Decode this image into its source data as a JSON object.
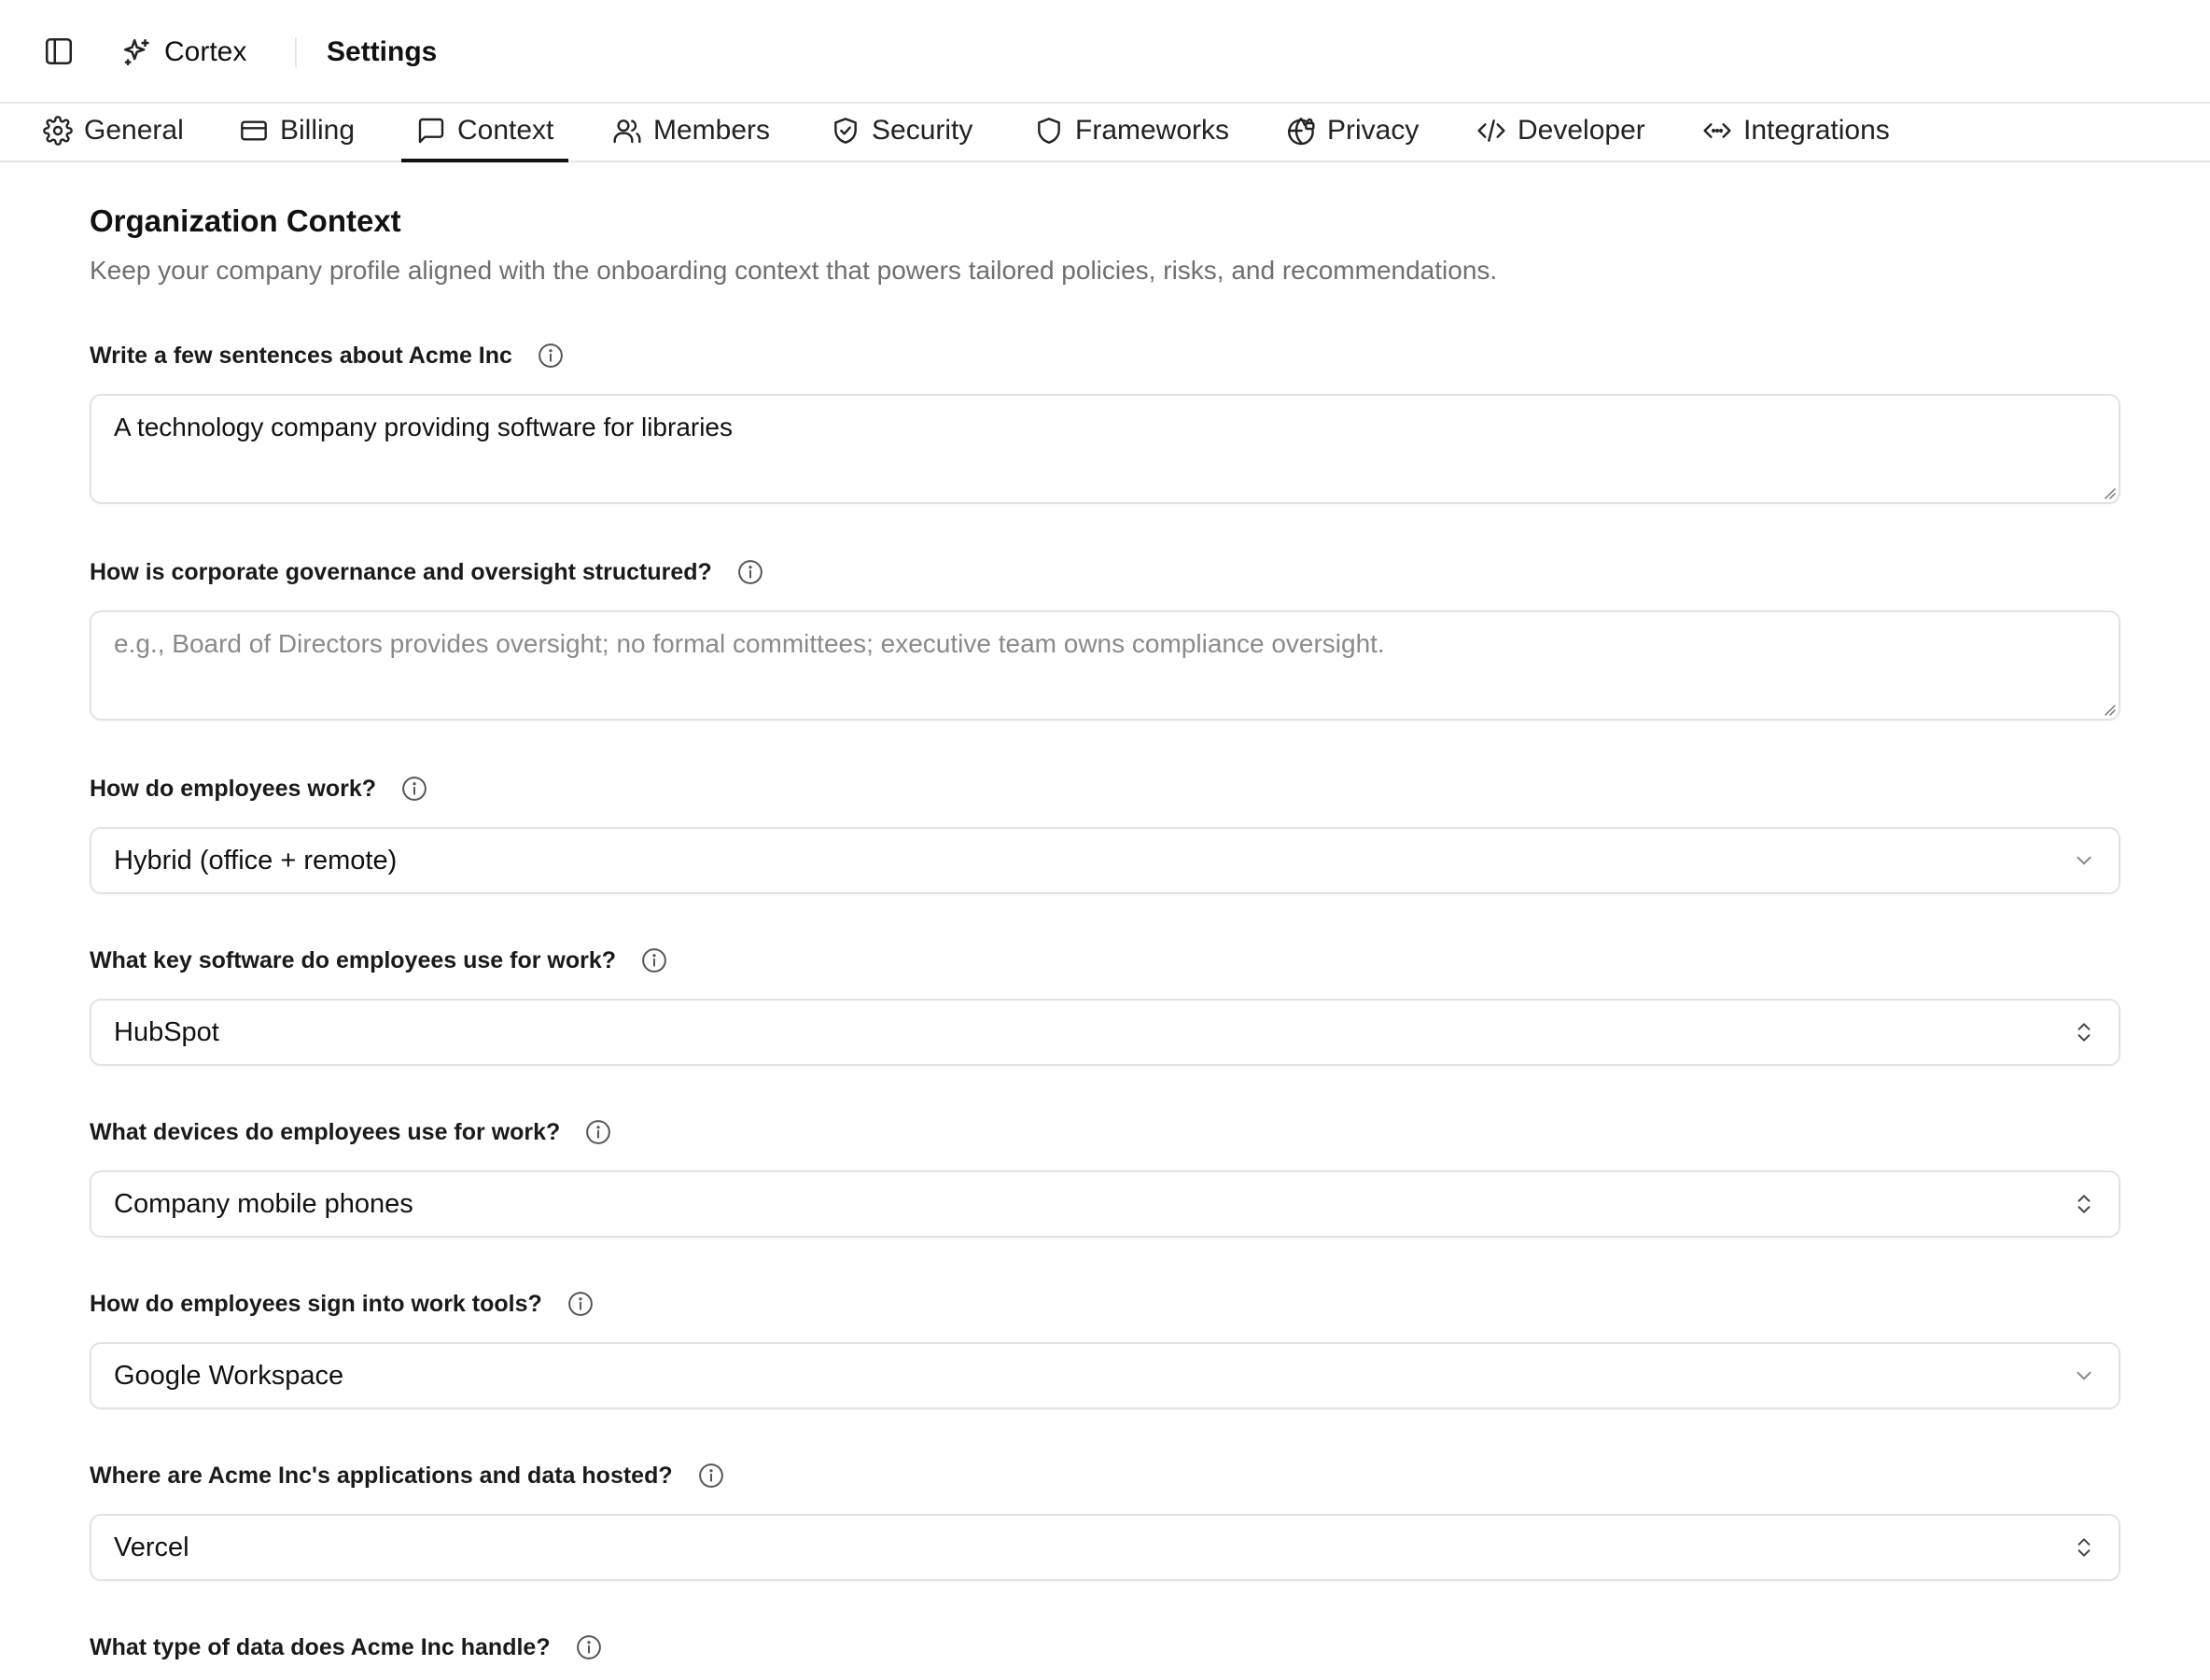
{
  "header": {
    "brand": "Cortex",
    "page_title": "Settings"
  },
  "tabs": [
    {
      "label": "General",
      "icon": "gear-icon",
      "active": false
    },
    {
      "label": "Billing",
      "icon": "credit-card-icon",
      "active": false
    },
    {
      "label": "Context",
      "icon": "message-square-icon",
      "active": true
    },
    {
      "label": "Members",
      "icon": "users-icon",
      "active": false
    },
    {
      "label": "Security",
      "icon": "shield-check-icon",
      "active": false
    },
    {
      "label": "Frameworks",
      "icon": "shield-icon",
      "active": false
    },
    {
      "label": "Privacy",
      "icon": "globe-lock-icon",
      "active": false
    },
    {
      "label": "Developer",
      "icon": "code-icon",
      "active": false
    },
    {
      "label": "Integrations",
      "icon": "code-arrows-icon",
      "active": false
    }
  ],
  "section": {
    "title": "Organization Context",
    "description": "Keep your company profile aligned with the onboarding context that powers tailored policies, risks, and recommendations."
  },
  "fields": {
    "about": {
      "label": "Write a few sentences about Acme Inc",
      "value": "A technology company providing software for libraries"
    },
    "governance": {
      "label": "How is corporate governance and oversight structured?",
      "placeholder": "e.g., Board of Directors provides oversight; no formal committees; executive team owns compliance oversight."
    },
    "work_mode": {
      "label": "How do employees work?",
      "value": "Hybrid (office + remote)"
    },
    "software": {
      "label": "What key software do employees use for work?",
      "value": "HubSpot"
    },
    "devices": {
      "label": "What devices do employees use for work?",
      "value": "Company mobile phones"
    },
    "sign_in": {
      "label": "How do employees sign into work tools?",
      "value": "Google Workspace"
    },
    "hosting": {
      "label": "Where are Acme Inc's applications and data hosted?",
      "value": "Vercel"
    },
    "data_type": {
      "label": "What type of data does Acme Inc handle?"
    }
  },
  "colors": {
    "border": "#e2e2e2",
    "muted_text": "#6f6f6f",
    "placeholder_text": "#8a8a8a",
    "active_tab_underline": "#111111"
  }
}
